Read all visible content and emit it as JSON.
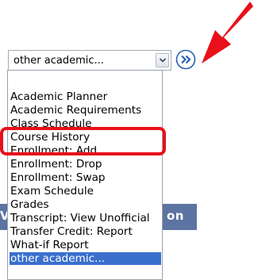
{
  "select": {
    "value": "other academic..."
  },
  "background_button": {
    "label_left": "V",
    "label_right": "on"
  },
  "dropdown": {
    "options": [
      {
        "label": "Academic Planner",
        "selected": false
      },
      {
        "label": "Academic Requirements",
        "selected": false
      },
      {
        "label": "Class Schedule",
        "selected": false
      },
      {
        "label": "Course History",
        "selected": false
      },
      {
        "label": "Enrollment: Add",
        "selected": false
      },
      {
        "label": "Enrollment: Drop",
        "selected": false
      },
      {
        "label": "Enrollment: Swap",
        "selected": false
      },
      {
        "label": "Exam Schedule",
        "selected": false
      },
      {
        "label": "Grades",
        "selected": false
      },
      {
        "label": "Transcript: View Unofficial",
        "selected": false
      },
      {
        "label": "Transfer Credit: Report",
        "selected": false
      },
      {
        "label": "What-if Report",
        "selected": false
      },
      {
        "label": "other academic...",
        "selected": true
      }
    ],
    "highlighted_option": "Course History"
  },
  "icons": {
    "go": "double-chevron-right-icon",
    "dropdown": "chevron-down-icon",
    "pointer": "red-arrow-icon"
  },
  "colors": {
    "selection": "#3a6fce",
    "highlight_border": "#e8101a",
    "arrow": "#e8101a",
    "background_button": "#5d74a3",
    "go_icon": "#2b5fb3"
  }
}
